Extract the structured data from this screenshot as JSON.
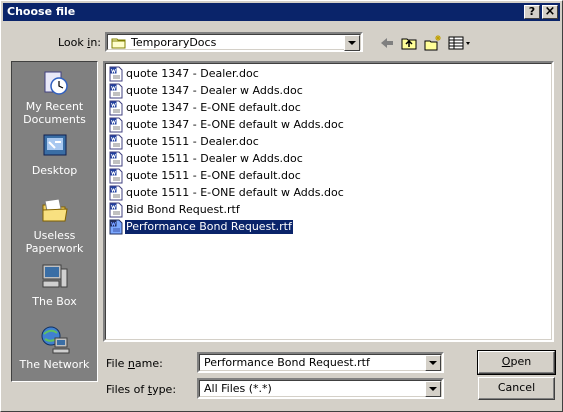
{
  "window": {
    "title": "Choose file",
    "help_button": "?",
    "close_button": "×"
  },
  "lookin": {
    "label_prefix": "Look ",
    "label_mnemonic": "i",
    "label_suffix": "n:",
    "value": "TemporaryDocs"
  },
  "toolbar": {
    "icons": [
      "back-arrow-icon",
      "up-one-level-icon",
      "create-new-folder-icon",
      "view-menu-icon"
    ]
  },
  "places": [
    {
      "label_line1": "My Recent",
      "label_line2": "Documents",
      "icon": "recent-documents-icon"
    },
    {
      "label_line1": "Desktop",
      "label_line2": "",
      "icon": "desktop-icon"
    },
    {
      "label_line1": "Useless",
      "label_line2": "Paperwork",
      "icon": "folder-icon"
    },
    {
      "label_line1": "The Box",
      "label_line2": "",
      "icon": "computer-icon"
    },
    {
      "label_line1": "The Network",
      "label_line2": "",
      "icon": "network-icon"
    }
  ],
  "files": [
    {
      "name": "quote 1347 - Dealer.doc",
      "type": "doc"
    },
    {
      "name": "quote 1347 - Dealer w Adds.doc",
      "type": "doc"
    },
    {
      "name": "quote 1347 - E-ONE default.doc",
      "type": "doc"
    },
    {
      "name": "quote 1347 - E-ONE default w Adds.doc",
      "type": "doc"
    },
    {
      "name": "quote 1511 - Dealer.doc",
      "type": "doc"
    },
    {
      "name": "quote 1511 - Dealer w Adds.doc",
      "type": "doc"
    },
    {
      "name": "quote 1511 - E-ONE default.doc",
      "type": "doc"
    },
    {
      "name": "quote 1511 - E-ONE default w Adds.doc",
      "type": "doc"
    },
    {
      "name": "Bid Bond Request.rtf",
      "type": "rtf"
    },
    {
      "name": "Performance Bond Request.rtf",
      "type": "rtf",
      "selected": true
    }
  ],
  "filename": {
    "label_prefix": "File ",
    "label_mnemonic": "n",
    "label_suffix": "ame:",
    "value": "Performance Bond Request.rtf"
  },
  "filetype": {
    "label_prefix": "Files of ",
    "label_mnemonic": "t",
    "label_suffix": "ype:",
    "value": "All Files (*.*)"
  },
  "buttons": {
    "open_mnemonic": "O",
    "open_rest": "pen",
    "cancel": "Cancel"
  },
  "colors": {
    "titlebar": "#0a246a",
    "dialog_face": "#d4d0c8",
    "places_bar": "#808080",
    "selection": "#0a246a"
  }
}
